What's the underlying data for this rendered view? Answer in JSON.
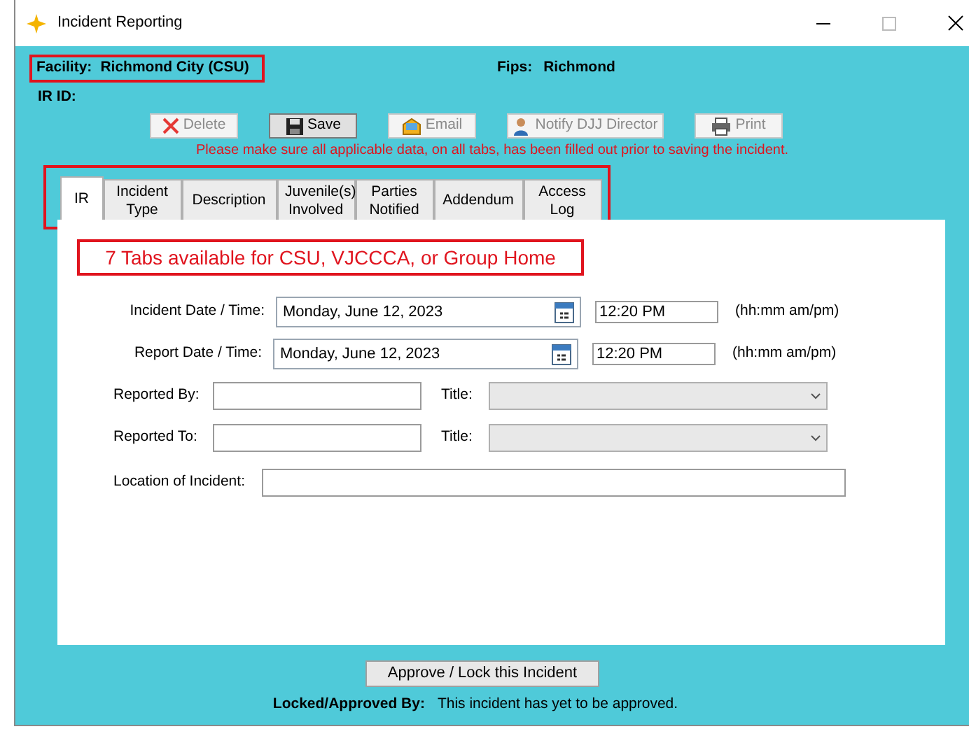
{
  "window": {
    "title": "Incident Reporting"
  },
  "header": {
    "facility_label": "Facility:",
    "facility_value": "Richmond City (CSU)",
    "facility_highlighted": true,
    "fips_label": "Fips:",
    "fips_value": "Richmond",
    "ir_id_label": "IR ID:"
  },
  "toolbar": [
    {
      "kind": "delete",
      "label": "Delete",
      "disabled": true
    },
    {
      "kind": "save",
      "label": "Save",
      "disabled": false
    },
    {
      "kind": "email",
      "label": "Email",
      "disabled": true
    },
    {
      "kind": "notify",
      "label": "Notify DJJ Director",
      "disabled": true
    },
    {
      "kind": "print",
      "label": "Print",
      "disabled": true
    }
  ],
  "warning": "Please make sure all applicable data, on all tabs, has been filled out prior to saving the incident.",
  "tabs_highlighted": true,
  "tabs": [
    {
      "label": "IR",
      "selected": true
    },
    {
      "label": "Incident Type",
      "selected": false
    },
    {
      "label": "Description",
      "selected": false
    },
    {
      "label": "Juvenile(s) Involved",
      "selected": false
    },
    {
      "label": "Parties Notified",
      "selected": false
    },
    {
      "label": "Addendum",
      "selected": false
    },
    {
      "label": "Access Log",
      "selected": false
    }
  ],
  "annotation": "7 Tabs available for CSU, VJCCCA, or Group Home",
  "form": {
    "incident_label": "Incident Date / Time:",
    "incident_date": "Monday, June 12, 2023",
    "incident_time": "12:20 PM",
    "incident_hint": "(hh:mm am/pm)",
    "report_label": "Report Date / Time:",
    "report_date": "Monday, June 12, 2023",
    "report_time": "12:20 PM",
    "report_hint": "(hh:mm am/pm)",
    "reported_by_label": "Reported By:",
    "reported_by_title_label": "Title:",
    "reported_to_label": "Reported To:",
    "reported_to_title_label": "Title:",
    "location_label": "Location of Incident:"
  },
  "footer": {
    "approve_button": "Approve / Lock this Incident",
    "locked_label": "Locked/Approved By:",
    "locked_value": "This incident has yet to be approved."
  }
}
